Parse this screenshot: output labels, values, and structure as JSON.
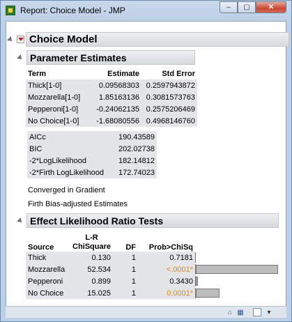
{
  "window": {
    "title": "Report: Choice Model - JMP",
    "controls": {
      "minimize": "–",
      "maximize": "▢",
      "close": "✕"
    }
  },
  "report": {
    "title": "Choice Model",
    "parameter_estimates": {
      "title": "Parameter Estimates",
      "headers": [
        "Term",
        "Estimate",
        "Std Error"
      ],
      "rows": [
        [
          "Thick[1-0]",
          "0.09568303",
          "0.2597943872"
        ],
        [
          "Mozzarella[1-0]",
          "1.85163136",
          "0.3081573763"
        ],
        [
          "Pepperoni[1-0]",
          "-0.24062135",
          "0.2575206469"
        ],
        [
          "No Choice[1-0]",
          "-1.68080556",
          "0.4968146760"
        ]
      ],
      "fit_stats": [
        [
          "AICc",
          "190.43589"
        ],
        [
          "BIC",
          "202.02738"
        ],
        [
          "-2*LogLikelihood",
          "182.14812"
        ],
        [
          "-2*Firth LogLikelihood",
          "172.74023"
        ]
      ],
      "notes": [
        "Converged in Gradient",
        "Firth Bias-adjusted Estimates"
      ]
    },
    "effect_lr_tests": {
      "title": "Effect Likelihood Ratio Tests",
      "headers": {
        "source": "Source",
        "lr_top": "L-R",
        "lr_bottom": "ChiSquare",
        "df": "DF",
        "prob": "Prob>ChiSq"
      },
      "rows": [
        {
          "source": "Thick",
          "chisq": "0.130",
          "df": "1",
          "prob": "0.7181",
          "significant": false,
          "bar_fraction": 0.0
        },
        {
          "source": "Mozzarella",
          "chisq": "52.534",
          "df": "1",
          "prob": "<.0001*",
          "significant": true,
          "bar_fraction": 1.0
        },
        {
          "source": "Pepperoni",
          "chisq": "0.899",
          "df": "1",
          "prob": "0.3430",
          "significant": false,
          "bar_fraction": 0.017
        },
        {
          "source": "No Choice",
          "chisq": "15.025",
          "df": "1",
          "prob": "0.0001*",
          "significant": true,
          "bar_fraction": 0.286
        }
      ]
    }
  },
  "statusbar": {
    "icons": [
      "home-icon",
      "table-icon",
      "checkbox-icon",
      "dropdown-icon"
    ]
  },
  "colors": {
    "significant_prob": "#e08a00",
    "red_triangle": "#d8161b",
    "bar_fill": "#bdbdbd"
  }
}
